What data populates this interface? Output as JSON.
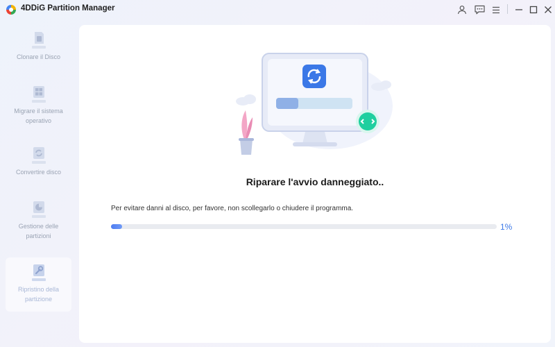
{
  "window": {
    "title": "4DDiG Partition Manager",
    "icons": [
      "user-icon",
      "feedback-icon",
      "menu-icon",
      "minimize-icon",
      "maximize-icon",
      "close-icon"
    ]
  },
  "sidebar": {
    "items": [
      {
        "label": "Clonare il Disco",
        "icon": "clone-disk-icon",
        "active": false
      },
      {
        "label": "Migrare il sistema\noperativo",
        "icon": "migrate-os-icon",
        "active": false
      },
      {
        "label": "Convertire disco",
        "icon": "convert-disk-icon",
        "active": false
      },
      {
        "label": "Gestione delle\npartizioni",
        "icon": "partition-management-icon",
        "active": true
      },
      {
        "label": "Ripristino della\npartizione",
        "icon": "partition-recovery-icon",
        "active": true
      }
    ]
  },
  "main": {
    "heading": "Riparare l'avvio danneggiato..",
    "warning": "Per evitare danni al disco, per favore, non scollegarlo o chiudere il programma.",
    "progress_value": 1,
    "progress_text": "1%"
  },
  "colors": {
    "accent": "#3b78e7",
    "sidebar_text": "#9aa3b3",
    "teal": "#1fcf9f"
  }
}
